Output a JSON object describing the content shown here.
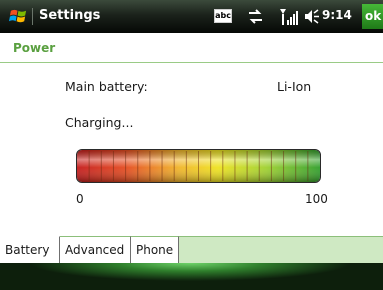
{
  "titlebar": {
    "title": "Settings",
    "input_indicator": "abc",
    "time": "9:14",
    "ok_label": "ok",
    "icons": [
      "windows-start-icon",
      "keyboard-abc-icon",
      "connectivity-icon",
      "signal-strength-icon",
      "volume-icon"
    ]
  },
  "header": {
    "title": "Power"
  },
  "battery": {
    "main_label": "Main battery:",
    "type_value": "Li-Ion",
    "status": "Charging...",
    "level_percent": 100,
    "min_label": "0",
    "max_label": "100"
  },
  "tabs": [
    {
      "label": "Battery",
      "selected": true
    },
    {
      "label": "Advanced",
      "selected": false
    },
    {
      "label": "Phone",
      "selected": false
    }
  ],
  "colors": {
    "accent_green": "#5aa040",
    "gauge_low": "#d21f1f",
    "gauge_mid": "#f0e020",
    "gauge_high": "#2fa42a"
  }
}
